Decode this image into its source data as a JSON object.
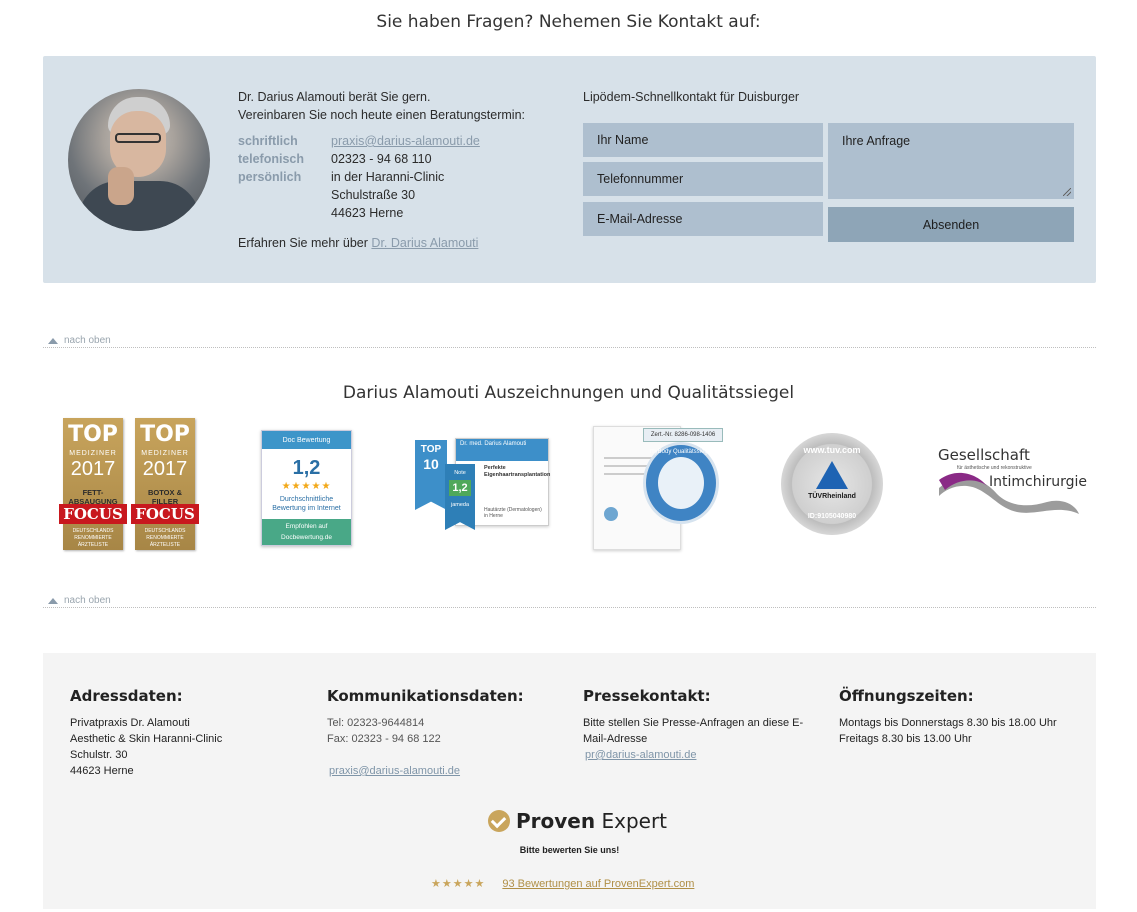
{
  "contact": {
    "heading": "Sie haben Fragen? Nehemen Sie Kontakt auf:",
    "intro_line1": "Dr. Darius Alamouti berät Sie gern.",
    "intro_line2": "Vereinbaren Sie noch heute einen Beratungstermin:",
    "rows": [
      {
        "label": "schriftlich",
        "value": "praxis@darius-alamouti.de"
      },
      {
        "label": "telefonisch",
        "value": "02323 - 94 68 110"
      },
      {
        "label": "persönlich",
        "value": "in der Haranni-Clinic"
      }
    ],
    "address_line2": "Schulstraße 30",
    "address_line3": "44623 Herne",
    "more_text": "Erfahren Sie mehr über",
    "more_link": "Dr. Darius Alamouti",
    "form": {
      "title": "Lipödem-Schnellkontakt für Duisburger",
      "name_placeholder": "Ihr Name",
      "phone_placeholder": "Telefonnummer",
      "email_placeholder": "E-Mail-Adresse",
      "request_placeholder": "Ihre Anfrage",
      "submit_label": "Absenden"
    }
  },
  "back_to_top": "nach oben",
  "awards": {
    "heading": "Darius Alamouti Auszeichnungen und Qualitätssiegel",
    "focus": [
      {
        "top": "TOP",
        "mediziner": "MEDIZINER",
        "year": "2017",
        "category": "FETT-ABSAUGUNG",
        "brand": "FOCUS",
        "sub": "DEUTSCHLANDS RENOMMIERTE ÄRZTELISTE"
      },
      {
        "top": "TOP",
        "mediziner": "MEDIZINER",
        "year": "2017",
        "category": "BOTOX & FILLER",
        "brand": "FOCUS",
        "sub": "DEUTSCHLANDS RENOMMIERTE ÄRZTELISTE"
      }
    ],
    "docbewertung": {
      "header": "Doc Bewertung",
      "score": "1,2",
      "stars": "★★★★★",
      "text": "Durchschnittliche Bewertung im Internet",
      "footer": "Empfohlen auf Docbewertung.de"
    },
    "jameda": {
      "top": "TOP",
      "top_num": "10",
      "note_label": "Note",
      "note": "1,2",
      "brand": "jameda",
      "card_title": "Dr. med. Darius Alamouti",
      "card_subtitle": "Perfekte Eigenhaartransplantation",
      "card_footer": "Hautärzte (Dermatologen) in Herne"
    },
    "mybody": {
      "cert_no": "Zert.-Nr. 8286-098-1406",
      "ring_text": "myBody Qualitätssiegel"
    },
    "tuv": {
      "url": "www.tuv.com",
      "name": "TÜVRheinland",
      "id": "ID:9105040980"
    },
    "society": {
      "line1": "Gesellschaft",
      "line2": "für ästhetische und rekonstruktive",
      "line3": "Intimchirurgie"
    }
  },
  "footer": {
    "address": {
      "title": "Adressdaten:",
      "lines": [
        "Privatpraxis Dr. Alamouti",
        "Aesthetic & Skin Haranni-Clinic",
        "Schulstr. 30",
        "44623 Herne"
      ]
    },
    "communication": {
      "title": "Kommunikationsdaten:",
      "tel": "Tel: 02323-9644814",
      "fax": "Fax: 02323 - 94 68 122",
      "email": "praxis@darius-alamouti.de"
    },
    "press": {
      "title": "Pressekontakt:",
      "text_line1": "Bitte stellen Sie Presse-Anfragen an diese E-",
      "text_line2": "Mail-Adresse",
      "email": "pr@darius-alamouti.de"
    },
    "hours": {
      "title": "Öffnungszeiten:",
      "line1": "Montags bis Donnerstags 8.30 bis 18.00 Uhr",
      "line2": "Freitags 8.30 bis 13.00 Uhr"
    },
    "proven_expert": {
      "brand_bold": "Proven",
      "brand_light": "Expert",
      "rate_text": "Bitte bewerten Sie uns!",
      "stars": "★★★★★",
      "reviews_link": "93 Bewertungen auf ProvenExpert.com"
    }
  },
  "colors": {
    "contact_bg": "#d7e1e9",
    "field_bg": "#aebfcf",
    "submit_bg": "#8ea5b7",
    "footer_bg": "#f4f4f4",
    "accent_gold": "#c9a55c"
  }
}
